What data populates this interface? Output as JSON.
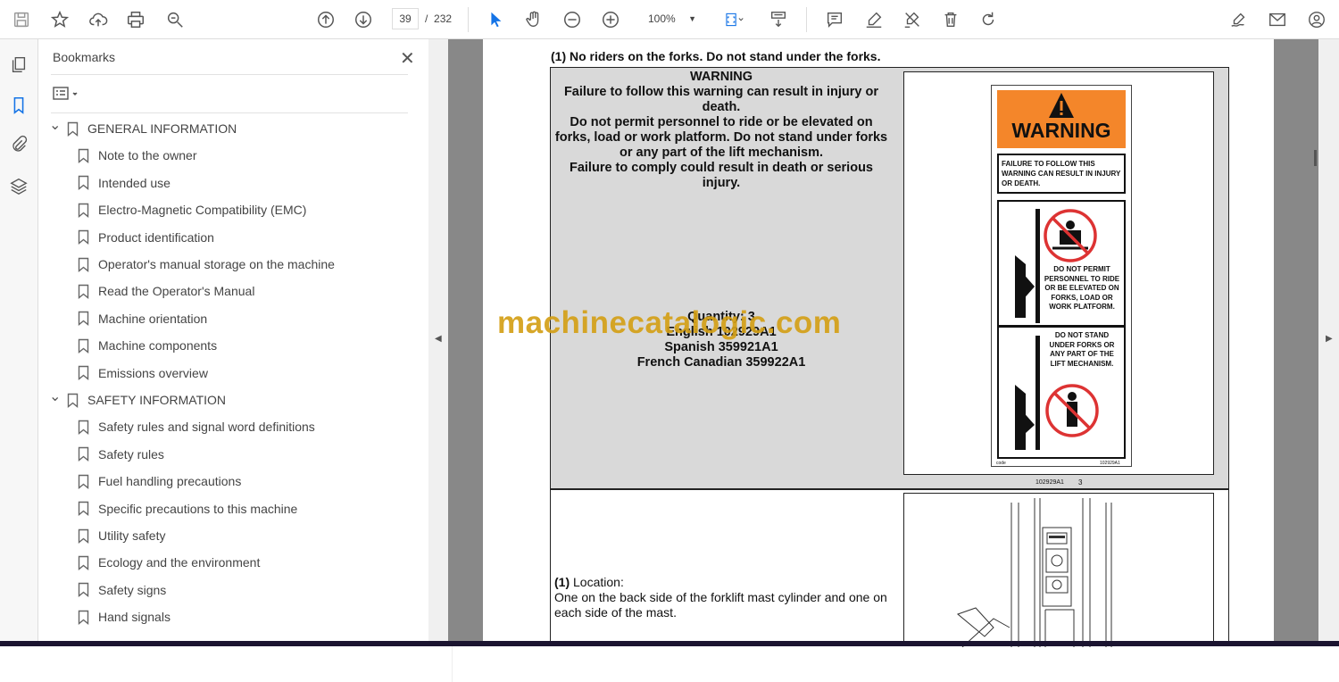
{
  "toolbar": {
    "page_current": "39",
    "page_sep": "/",
    "page_total": "232",
    "zoom": "100%"
  },
  "bookmarks": {
    "title": "Bookmarks",
    "items": [
      {
        "label": "GENERAL INFORMATION",
        "level": 0
      },
      {
        "label": "Note to the owner",
        "level": 1
      },
      {
        "label": "Intended use",
        "level": 1
      },
      {
        "label": "Electro-Magnetic Compatibility (EMC)",
        "level": 1
      },
      {
        "label": "Product identification",
        "level": 1
      },
      {
        "label": "Operator's manual storage on the machine",
        "level": 1
      },
      {
        "label": "Read the Operator's Manual",
        "level": 1
      },
      {
        "label": "Machine orientation",
        "level": 1
      },
      {
        "label": "Machine components",
        "level": 1
      },
      {
        "label": "Emissions overview",
        "level": 1
      },
      {
        "label": "SAFETY INFORMATION",
        "level": 0
      },
      {
        "label": "Safety rules and signal word definitions",
        "level": 1
      },
      {
        "label": "Safety rules",
        "level": 1
      },
      {
        "label": "Fuel handling precautions",
        "level": 1
      },
      {
        "label": "Specific precautions to this machine",
        "level": 1
      },
      {
        "label": "Utility safety",
        "level": 1
      },
      {
        "label": "Ecology and the environment",
        "level": 1
      },
      {
        "label": "Safety signs",
        "level": 1
      },
      {
        "label": "Hand signals",
        "level": 1
      }
    ]
  },
  "document": {
    "heading": "(1) No riders on the forks.  Do not stand under the forks.",
    "warning_lines": [
      "WARNING",
      "Failure to follow this warning can result in injury or death.",
      "Do not permit personnel to ride or be elevated on forks, load or work platform.  Do not stand under forks or any part of the lift mechanism.",
      "Failure to comply could result in death or serious injury."
    ],
    "quantity_lines": [
      "Quantity: 3",
      "English 102929A1",
      "Spanish 359921A1",
      "French Canadian 359922A1"
    ],
    "decal": {
      "header": "WARNING",
      "box_text": "FAILURE TO FOLLOW THIS WARNING CAN RESULT IN INJURY OR DEATH.",
      "text_a": "DO NOT PERMIT PERSONNEL TO RIDE OR BE ELEVATED ON FORKS, LOAD OR WORK PLATFORM.",
      "text_b": "DO NOT STAND UNDER FORKS OR ANY PART OF THE LIFT MECHANISM.",
      "code_left": "code",
      "code_right": "102929A1"
    },
    "caption": "102929A1",
    "caption_num": "3",
    "location_label": "(1)",
    "location_title": "Location:",
    "location_text": "One on the back side of the forklift mast cylinder and one on each side of the mast."
  },
  "watermark": "machinecatalogic.com",
  "colors": {
    "accent": "#1473e6",
    "decal_orange": "#f4862a",
    "watermark": "#d4a017"
  }
}
